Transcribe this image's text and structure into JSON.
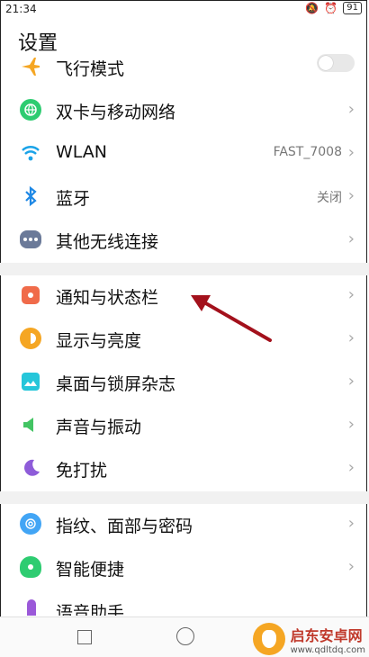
{
  "status_bar": {
    "time": "21:34",
    "battery": "91"
  },
  "header": {
    "title": "设置"
  },
  "items": [
    {
      "label": "飞行模式",
      "icon": "airplane-icon",
      "color": "#f5a623",
      "control": "toggle",
      "value": "",
      "chevron": ""
    },
    {
      "label": "双卡与移动网络",
      "icon": "globe-icon",
      "color": "#2ecc71",
      "control": "chevron",
      "value": "",
      "chevron": "›"
    },
    {
      "label": "WLAN",
      "icon": "wifi-icon",
      "color": "#1aa3e8",
      "control": "chevron",
      "value": "FAST_7008",
      "chevron": "›"
    },
    {
      "label": "蓝牙",
      "icon": "bluetooth-icon",
      "color": "#1e88e5",
      "control": "chevron",
      "value": "关闭",
      "chevron": "›"
    },
    {
      "label": "其他无线连接",
      "icon": "more-dots-icon",
      "color": "#6b7a99",
      "control": "chevron",
      "value": "",
      "chevron": "›"
    },
    {
      "label": "通知与状态栏",
      "icon": "notification-icon",
      "color": "#f06b4a",
      "control": "chevron",
      "value": "",
      "chevron": "›"
    },
    {
      "label": "显示与亮度",
      "icon": "brightness-icon",
      "color": "#f5a623",
      "control": "chevron",
      "value": "",
      "chevron": "›"
    },
    {
      "label": "桌面与锁屏杂志",
      "icon": "wallpaper-icon",
      "color": "#26c6da",
      "control": "chevron",
      "value": "",
      "chevron": "›"
    },
    {
      "label": "声音与振动",
      "icon": "speaker-icon",
      "color": "#43c463",
      "control": "chevron",
      "value": "",
      "chevron": "›"
    },
    {
      "label": "免打扰",
      "icon": "moon-icon",
      "color": "#8e5cd9",
      "control": "chevron",
      "value": "",
      "chevron": "›"
    },
    {
      "label": "指纹、面部与密码",
      "icon": "fingerprint-icon",
      "color": "#42a5f5",
      "control": "chevron",
      "value": "",
      "chevron": "›"
    },
    {
      "label": "智能便捷",
      "icon": "smart-head-icon",
      "color": "#2ecc71",
      "control": "chevron",
      "value": "",
      "chevron": "›"
    },
    {
      "label": "语音助手",
      "icon": "voice-assistant-icon",
      "color": "#9b59d9",
      "control": "chevron",
      "value": "",
      "chevron": "›"
    }
  ],
  "watermark": {
    "title": "启东安卓网",
    "url": "www.qdltdq.com"
  }
}
